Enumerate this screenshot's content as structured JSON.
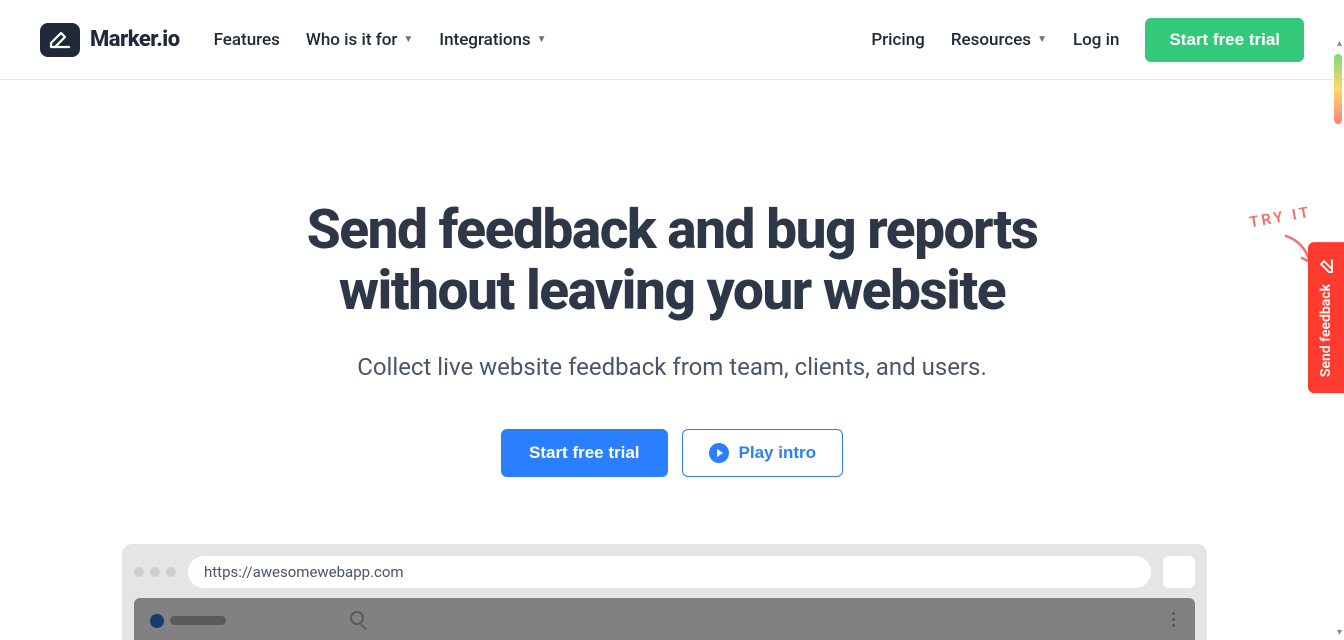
{
  "brand": "Marker.io",
  "nav": {
    "features": "Features",
    "who": "Who is it for",
    "integrations": "Integrations",
    "pricing": "Pricing",
    "resources": "Resources",
    "login": "Log in"
  },
  "cta": {
    "header": "Start free trial",
    "hero_primary": "Start free trial",
    "hero_secondary": "Play intro"
  },
  "hero": {
    "title_line1": "Send feedback and bug reports",
    "title_line2": "without leaving your website",
    "subtitle": "Collect live website feedback from team, clients, and users."
  },
  "browser": {
    "url": "https://awesomewebapp.com"
  },
  "widget": {
    "label": "Send feedback"
  },
  "tryit": "TRY IT"
}
